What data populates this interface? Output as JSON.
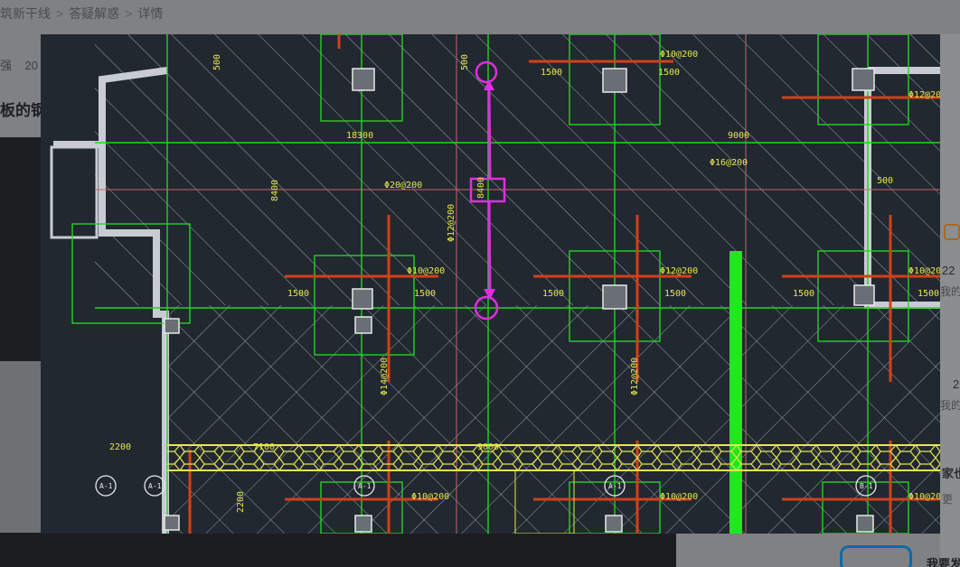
{
  "breadcrumb": {
    "items": [
      "筑新干线",
      "答疑解惑",
      "详情"
    ],
    "separator": ">"
  },
  "post": {
    "author_fragment": "强",
    "date_fragment": "20",
    "title_fragment": "板的钢"
  },
  "right_panel": {
    "stat1": "22",
    "sub1": "我的",
    "stat2": "2",
    "sub2": "我的",
    "heading": "家也",
    "sub3": "更"
  },
  "bottom_right": {
    "label": "我要发"
  },
  "drawing": {
    "dims": {
      "top_span": "18300",
      "right_span": "9000",
      "left_height": "8400",
      "bottom_left": "2200",
      "bottom_mid1": "7100",
      "bottom_mid2": "9000",
      "bottom_vert": "2200",
      "measure_center": "8400"
    },
    "pile_labels": [
      "1500",
      "1500",
      "1500",
      "1500",
      "1500",
      "1500",
      "1500",
      "1500",
      "500",
      "500",
      "500"
    ],
    "rebar_labels": {
      "r1": "Φ10@200",
      "r2": "Φ20@200",
      "r3": "Φ12@200",
      "r4": "Φ16@200",
      "r5": "Φ10@200",
      "r6": "Φ12@200",
      "r7": "Φ10@200",
      "r8": "Φ12@200",
      "r9": "Φ10@200",
      "r10": "Φ14@200",
      "r11": "Φ12@200",
      "r12": "Φ10@200",
      "r13": "Φ10@200"
    },
    "axis_bubbles": [
      "A-1",
      "A-1",
      "A-1",
      "A-1",
      "B-1"
    ]
  },
  "colors": {
    "cad_background": "#212830",
    "grid_green": "#22d422",
    "rebar_red": "#d2401a",
    "measure_magenta": "#e02ee0",
    "dim_yellow": "#e6e650",
    "hatch_white": "#c8ccd2"
  }
}
